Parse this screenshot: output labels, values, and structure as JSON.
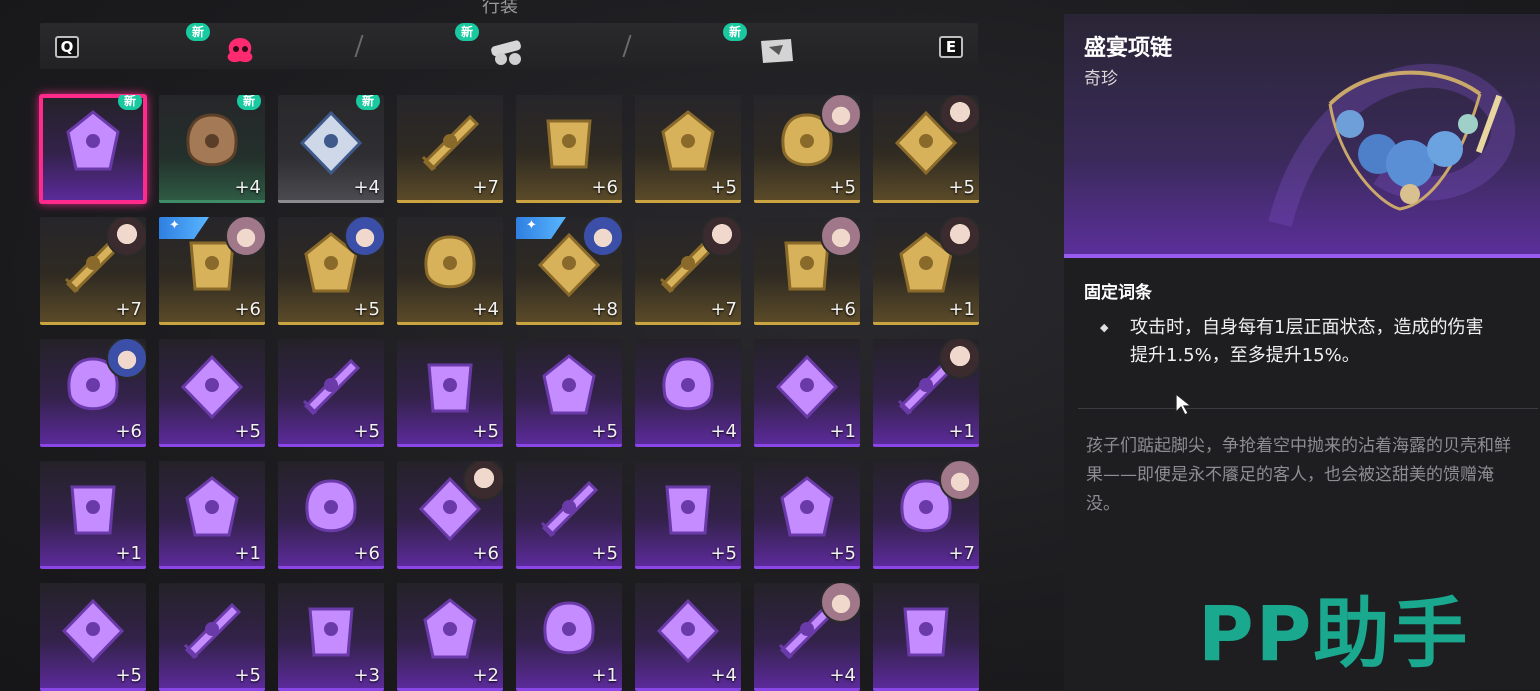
{
  "window_title": "行装",
  "tabs": {
    "prev_key": "Q",
    "next_key": "E",
    "items": [
      {
        "icon": "mask-flower-icon",
        "new": "新",
        "active": true
      },
      {
        "icon": "cannon-icon",
        "new": "新",
        "active": false
      },
      {
        "icon": "scroll-flag-icon",
        "new": "新",
        "active": false
      }
    ]
  },
  "inventory": [
    {
      "name": "necklace",
      "rarity": "purple",
      "plus": "",
      "new": "新",
      "selected": true
    },
    {
      "name": "hood",
      "rarity": "green",
      "plus": "+4",
      "new": "新"
    },
    {
      "name": "striped-shirt",
      "rarity": "gray",
      "plus": "+4",
      "new": "新"
    },
    {
      "name": "dagger",
      "rarity": "gold",
      "plus": "+7"
    },
    {
      "name": "skull-helm",
      "rarity": "gold",
      "plus": "+6"
    },
    {
      "name": "skull-helm",
      "rarity": "gold",
      "plus": "+5"
    },
    {
      "name": "flame-gauntlet",
      "rarity": "gold",
      "plus": "+5",
      "avatar": "pink"
    },
    {
      "name": "gold-gauntlet",
      "rarity": "gold",
      "plus": "+5",
      "avatar": "dark"
    },
    {
      "name": "ship-model",
      "rarity": "gold",
      "plus": "+7",
      "avatar": "dark"
    },
    {
      "name": "blue-mask",
      "rarity": "gold",
      "plus": "+6",
      "avatar": "pink",
      "ribbon": true
    },
    {
      "name": "gold-helm",
      "rarity": "gold",
      "plus": "+5",
      "avatar": "blue"
    },
    {
      "name": "pirate-hat",
      "rarity": "gold",
      "plus": "+4"
    },
    {
      "name": "leaf-armor",
      "rarity": "gold",
      "plus": "+8",
      "avatar": "blue",
      "ribbon": true
    },
    {
      "name": "red-beast",
      "rarity": "gold",
      "plus": "+7",
      "avatar": "dark"
    },
    {
      "name": "red-armor",
      "rarity": "gold",
      "plus": "+6",
      "avatar": "pink"
    },
    {
      "name": "purple-gauntlet",
      "rarity": "gold",
      "plus": "+1",
      "avatar": "dark"
    },
    {
      "name": "flintlock",
      "rarity": "purple",
      "plus": "+6",
      "avatar": "blue"
    },
    {
      "name": "scimitar",
      "rarity": "purple",
      "plus": "+5"
    },
    {
      "name": "harp-blue",
      "rarity": "purple",
      "plus": "+5"
    },
    {
      "name": "potion",
      "rarity": "purple",
      "plus": "+5"
    },
    {
      "name": "harp-pink",
      "rarity": "purple",
      "plus": "+5"
    },
    {
      "name": "flintlock",
      "rarity": "purple",
      "plus": "+4"
    },
    {
      "name": "dagger-dark",
      "rarity": "purple",
      "plus": "+1"
    },
    {
      "name": "dagger-dark",
      "rarity": "purple",
      "plus": "+1",
      "avatar": "dark"
    },
    {
      "name": "banner",
      "rarity": "purple",
      "plus": "+1"
    },
    {
      "name": "harp-gold",
      "rarity": "purple",
      "plus": "+1"
    },
    {
      "name": "jester-mask",
      "rarity": "purple",
      "plus": "+6"
    },
    {
      "name": "gold-mask",
      "rarity": "purple",
      "plus": "+6",
      "avatar": "dark"
    },
    {
      "name": "jester-mask",
      "rarity": "purple",
      "plus": "+5"
    },
    {
      "name": "witch-hat",
      "rarity": "purple",
      "plus": "+5"
    },
    {
      "name": "top-hat",
      "rarity": "purple",
      "plus": "+5"
    },
    {
      "name": "steel-armor",
      "rarity": "purple",
      "plus": "+7",
      "avatar": "pink"
    },
    {
      "name": "cloak",
      "rarity": "purple",
      "plus": "+5"
    },
    {
      "name": "plate-armor",
      "rarity": "purple",
      "plus": "+5"
    },
    {
      "name": "vest",
      "rarity": "purple",
      "plus": "+3"
    },
    {
      "name": "feather-mantle",
      "rarity": "purple",
      "plus": "+2"
    },
    {
      "name": "iron-armor",
      "rarity": "purple",
      "plus": "+1"
    },
    {
      "name": "boot",
      "rarity": "purple",
      "plus": "+4"
    },
    {
      "name": "tall-boot",
      "rarity": "purple",
      "plus": "+4",
      "avatar": "pink"
    },
    {
      "name": "blue-gem",
      "rarity": "purple",
      "plus": ""
    }
  ],
  "detail": {
    "name": "盛宴项链",
    "rarity": "奇珍",
    "section_title": "固定词条",
    "effect": "攻击时，自身每有1层正面状态，造成的伤害提升1.5%，至多提升15%。",
    "lore": "孩子们踮起脚尖，争抢着空中抛来的沾着海露的贝壳和鲜果——即便是永不餍足的客人，也会被这甜美的馈赠淹没。"
  },
  "watermark": "PP助手",
  "colors": {
    "gold": "#c9a441",
    "purple": "#8a46e6",
    "green": "#3f8d68",
    "selected": "#ff2a8c",
    "new_tag": "#19c9a0"
  }
}
